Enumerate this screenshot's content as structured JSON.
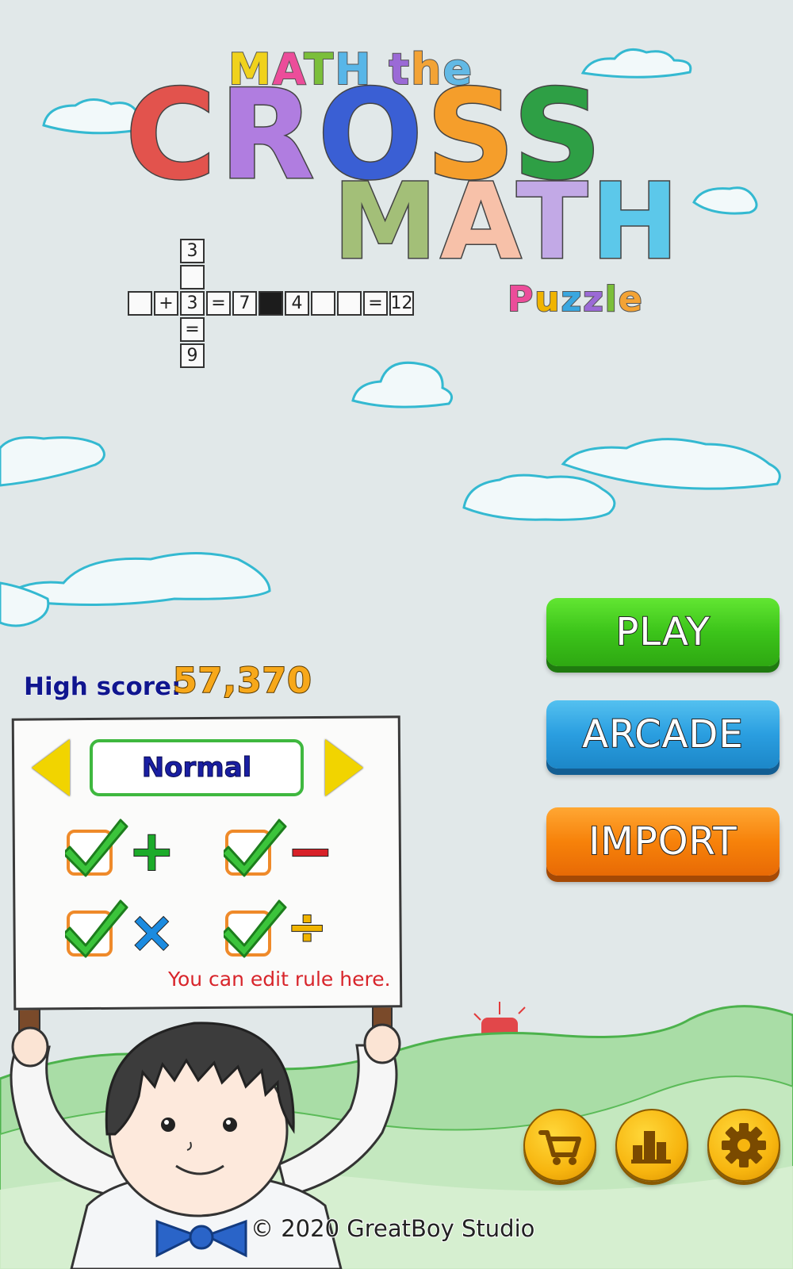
{
  "title": {
    "line1": "MATH the",
    "cross_letters": [
      {
        "ch": "C",
        "color": "#e2534d"
      },
      {
        "ch": "R",
        "color": "#b07de0"
      },
      {
        "ch": "O",
        "color": "#3a5fd4"
      },
      {
        "ch": "S",
        "color": "#f59e2b"
      },
      {
        "ch": "S",
        "color": "#2e9f45"
      }
    ],
    "math_letters": [
      {
        "ch": "M",
        "color": "#a3bf78"
      },
      {
        "ch": "A",
        "color": "#f7c1a9"
      },
      {
        "ch": "T",
        "color": "#c2a9e6"
      },
      {
        "ch": "H",
        "color": "#5cc8ea"
      }
    ],
    "puzzle": "Puzzle",
    "line1_colors": [
      "#f0d21c",
      "#ec4d9a",
      "#7bbf3a",
      "#58b6e8",
      "#9b6ad6",
      "#f3a335",
      "#62b9e5",
      "#b68cd8"
    ]
  },
  "mini_grid": {
    "vertical": [
      "3",
      "",
      "3",
      "=",
      "9"
    ],
    "horizontal": [
      "",
      "+",
      "3",
      "=",
      "7",
      "#",
      "4",
      "",
      "",
      "=",
      "12"
    ]
  },
  "menu": {
    "play": "PLAY",
    "arcade": "ARCADE",
    "import": "IMPORT"
  },
  "high_score": {
    "label": "High score:",
    "value": "57,370"
  },
  "rules": {
    "mode": "Normal",
    "operators": [
      {
        "symbol": "+",
        "checked": true,
        "color": "#1cab2a"
      },
      {
        "symbol": "−",
        "checked": true,
        "color": "#d82128"
      },
      {
        "symbol": "×",
        "checked": true,
        "color": "#1b8be0"
      },
      {
        "symbol": "÷",
        "checked": true,
        "color": "#f0b400"
      }
    ],
    "hint": "You can edit rule here."
  },
  "toolbar_icons": [
    "cart-icon",
    "leaderboard-icon",
    "gear-icon"
  ],
  "footer": "© 2020 GreatBoy Studio"
}
